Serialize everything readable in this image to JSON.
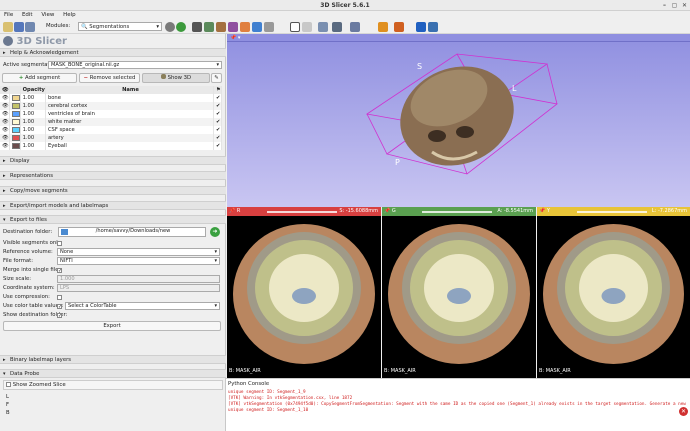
{
  "window": {
    "title": "3D Slicer 5.6.1"
  },
  "menu": [
    "File",
    "Edit",
    "View",
    "Help"
  ],
  "toolbar": {
    "modules_label": "Modules:",
    "module_selected": "Segmentations"
  },
  "logo": "3D Slicer",
  "sections": {
    "help": "Help & Acknowledgement",
    "display": "Display",
    "representations": "Representations",
    "copy_move": "Copy/move segments",
    "export_import": "Export/import models and labelmaps",
    "export_files": "Export to files",
    "binary": "Binary labelmap layers",
    "data_probe": "Data Probe"
  },
  "active_segmentation": {
    "label": "Active segmentation:",
    "value": "MASK_BONE_original.nii.gz"
  },
  "buttons": {
    "add": "Add segment",
    "remove": "Remove selected",
    "show3d": "Show 3D",
    "export": "Export"
  },
  "segment_table": {
    "headers": [
      "Opacity",
      "Name"
    ],
    "rows": [
      {
        "opacity": "1.00",
        "name": "bone",
        "color": "#f1d691"
      },
      {
        "opacity": "1.00",
        "name": "cerebral cortex",
        "color": "#c2c26a"
      },
      {
        "opacity": "1.00",
        "name": "ventricles of brain",
        "color": "#5aa0ff"
      },
      {
        "opacity": "1.00",
        "name": "white matter",
        "color": "#fffad2"
      },
      {
        "opacity": "1.00",
        "name": "CSF space",
        "color": "#5ad2ff"
      },
      {
        "opacity": "1.00",
        "name": "artery",
        "color": "#e05050"
      },
      {
        "opacity": "1.00",
        "name": "Eyeball",
        "color": "#6a4d4d"
      }
    ]
  },
  "export_form": {
    "destination_label": "Destination folder:",
    "destination_value": "/home/savvy/Downloads/new",
    "visible_only_label": "Visible segments only:",
    "reference_volume_label": "Reference volume:",
    "reference_volume_value": "None",
    "file_format_label": "File format:",
    "file_format_value": "NIFTI",
    "merge_label": "Merge into single file:",
    "size_scale_label": "Size scale:",
    "size_scale_value": "1.000",
    "coord_label": "Coordinate system:",
    "coord_value": "LPS",
    "compression_label": "Use compression:",
    "color_table_label": "Use color table values:",
    "color_table_value": "Select a ColorTable",
    "show_dest_label": "Show destination folder:"
  },
  "show_zoomed": "Show Zoomed Slice",
  "probe_letters": [
    "L",
    "F",
    "B"
  ],
  "view3d": {
    "orient_s": "S",
    "orient_l": "L",
    "orient_p": "P"
  },
  "slices": [
    {
      "label": "R",
      "value": "S: -15.6088mm",
      "footer": "B: MASK_AIR",
      "color": "#d84040"
    },
    {
      "label": "G",
      "value": "A: -8.5541mm",
      "footer": "B: MASK_AIR",
      "color": "#5aa050"
    },
    {
      "label": "Y",
      "value": "L: -7.2867mm",
      "footer": "B: MASK_AIR",
      "color": "#e8c438"
    }
  ],
  "python_console": {
    "title": "Python Console",
    "lines": [
      "unique segment ID: Segment_1_9",
      "[VTK] Warning: In vtkSegmentation.cxx, line 1872",
      "[VTK] vtkSegmentation (0x7494f5d0): CopySegmentFromSegmentation: Segment with the same ID as the copied one (Segment_1) already exists in the target segmentation. Generate a new",
      "unique segment ID: Segment_1_10"
    ]
  }
}
